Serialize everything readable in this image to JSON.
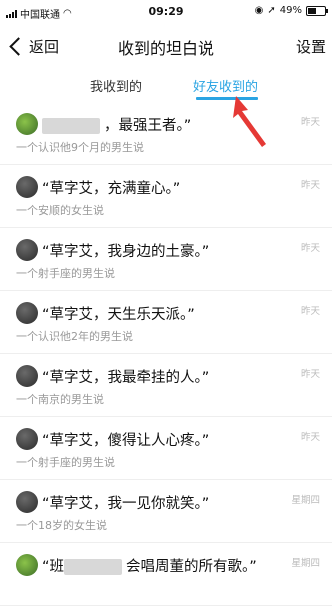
{
  "status": {
    "carrier": "中国联通",
    "time": "09:29",
    "battery": "49%",
    "battery_level": 0.49
  },
  "nav": {
    "back": "返回",
    "title": "收到的坦白说",
    "settings": "设置"
  },
  "tabs": {
    "received": "我收到的",
    "friends": "好友收到的"
  },
  "items": [
    {
      "message": "，最强王者。”",
      "sub": "一个认识他9个月的男生说",
      "time": "昨天"
    },
    {
      "message": "“草字艾，充满童心。”",
      "sub": "一个安顺的女生说",
      "time": "昨天"
    },
    {
      "message": "“草字艾，我身边的土豪。”",
      "sub": "一个射手座的男生说",
      "time": "昨天"
    },
    {
      "message": "“草字艾，天生乐天派。”",
      "sub": "一个认识他2年的男生说",
      "time": "昨天"
    },
    {
      "message": "“草字艾，我最牵挂的人。”",
      "sub": "一个南京的男生说",
      "time": "昨天"
    },
    {
      "message": "“草字艾，傻得让人心疼。”",
      "sub": "一个射手座的男生说",
      "time": "昨天"
    },
    {
      "message": "“草字艾，我一见你就笑。”",
      "sub": "一个18岁的女生说",
      "time": "星期四"
    },
    {
      "message": "“班",
      "message_suffix": "会唱周董的所有歌。”",
      "sub": "",
      "time": "星期四"
    }
  ]
}
